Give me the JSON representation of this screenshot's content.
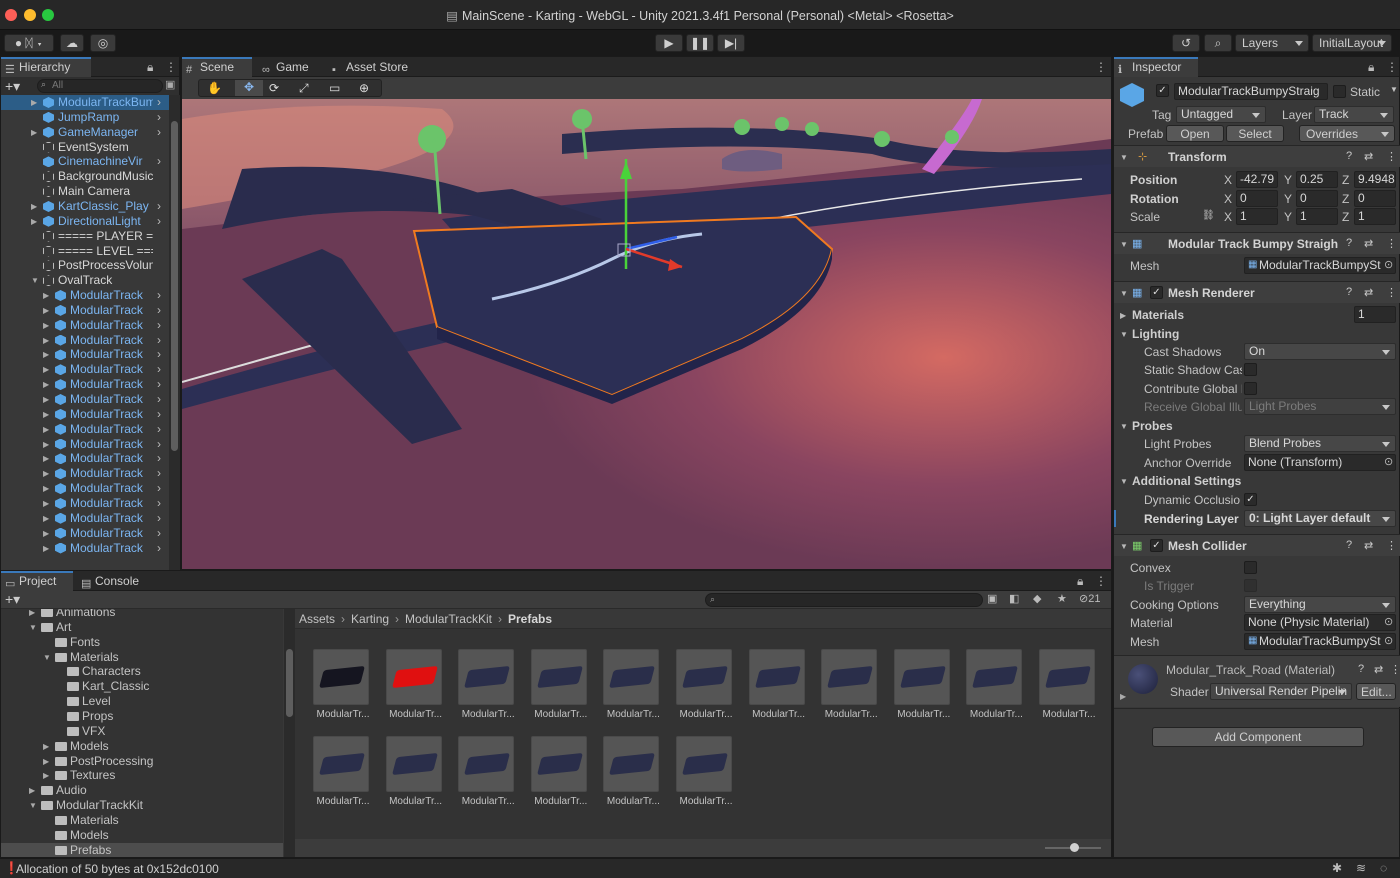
{
  "window": {
    "title": "MainScene - Karting - WebGL - Unity 2021.3.4f1 Personal (Personal) <Metal> <Rosetta>"
  },
  "toolbar": {
    "layers_label": "Layers",
    "layout_label": "InitialLayout"
  },
  "hierarchy": {
    "tab_label": "Hierarchy",
    "search_placeholder": "All",
    "items": [
      {
        "label": "ModularTrackBump",
        "color": "blue",
        "depth": 2,
        "expand": true,
        "chevron": true
      },
      {
        "label": "JumpRamp",
        "color": "blue",
        "depth": 2,
        "expand": false,
        "chevron": true
      },
      {
        "label": "GameManager",
        "color": "blue",
        "depth": 2,
        "expand": true,
        "chevron": true
      },
      {
        "label": "EventSystem",
        "color": "white",
        "depth": 2,
        "expand": false,
        "chevron": false
      },
      {
        "label": "CinemachineVir",
        "color": "blue",
        "depth": 2,
        "expand": false,
        "chevron": true
      },
      {
        "label": "BackgroundMusic",
        "color": "white",
        "depth": 2,
        "expand": false,
        "chevron": false
      },
      {
        "label": "Main Camera",
        "color": "white",
        "depth": 2,
        "expand": false,
        "chevron": false
      },
      {
        "label": "KartClassic_Play",
        "color": "blue",
        "depth": 2,
        "expand": true,
        "chevron": true
      },
      {
        "label": "DirectionalLight",
        "color": "blue",
        "depth": 2,
        "expand": true,
        "chevron": true
      },
      {
        "label": "===== PLAYER ====",
        "color": "white",
        "depth": 2,
        "expand": false,
        "chevron": false
      },
      {
        "label": "===== LEVEL =====",
        "color": "white",
        "depth": 2,
        "expand": false,
        "chevron": false
      },
      {
        "label": "PostProcessVolum",
        "color": "white",
        "depth": 2,
        "expand": false,
        "chevron": false
      },
      {
        "label": "OvalTrack",
        "color": "white",
        "depth": 2,
        "expand": true,
        "open": true,
        "chevron": false
      },
      {
        "label": "ModularTrack",
        "color": "blue",
        "depth": 3,
        "expand": true,
        "chevron": true
      },
      {
        "label": "ModularTrack",
        "color": "blue",
        "depth": 3,
        "expand": true,
        "chevron": true
      },
      {
        "label": "ModularTrack",
        "color": "blue",
        "depth": 3,
        "expand": true,
        "chevron": true
      },
      {
        "label": "ModularTrack",
        "color": "blue",
        "depth": 3,
        "expand": true,
        "chevron": true
      },
      {
        "label": "ModularTrack",
        "color": "blue",
        "depth": 3,
        "expand": true,
        "chevron": true
      },
      {
        "label": "ModularTrack",
        "color": "blue",
        "depth": 3,
        "expand": true,
        "chevron": true
      },
      {
        "label": "ModularTrack",
        "color": "blue",
        "depth": 3,
        "expand": true,
        "chevron": true
      },
      {
        "label": "ModularTrack",
        "color": "blue",
        "depth": 3,
        "expand": true,
        "chevron": true
      },
      {
        "label": "ModularTrack",
        "color": "blue",
        "depth": 3,
        "expand": true,
        "chevron": true
      },
      {
        "label": "ModularTrack",
        "color": "blue",
        "depth": 3,
        "expand": true,
        "chevron": true
      },
      {
        "label": "ModularTrack",
        "color": "blue",
        "depth": 3,
        "expand": true,
        "chevron": true
      },
      {
        "label": "ModularTrack",
        "color": "blue",
        "depth": 3,
        "expand": true,
        "chevron": true
      },
      {
        "label": "ModularTrack",
        "color": "blue",
        "depth": 3,
        "expand": true,
        "chevron": true
      },
      {
        "label": "ModularTrack",
        "color": "blue",
        "depth": 3,
        "expand": true,
        "chevron": true
      },
      {
        "label": "ModularTrack",
        "color": "blue",
        "depth": 3,
        "expand": true,
        "chevron": true
      },
      {
        "label": "ModularTrack",
        "color": "blue",
        "depth": 3,
        "expand": true,
        "chevron": true
      },
      {
        "label": "ModularTrack",
        "color": "blue",
        "depth": 3,
        "expand": true,
        "chevron": true
      },
      {
        "label": "ModularTrack",
        "color": "blue",
        "depth": 3,
        "expand": true,
        "chevron": true
      }
    ]
  },
  "scene_tabs": [
    {
      "label": "Scene",
      "icon": "#"
    },
    {
      "label": "Game",
      "icon": "∞"
    },
    {
      "label": "Asset Store",
      "icon": "▪"
    }
  ],
  "project": {
    "tabs": [
      {
        "label": "Project"
      },
      {
        "label": "Console"
      }
    ],
    "hidden_count": "21",
    "breadcrumb": [
      "Assets",
      "Karting",
      "ModularTrackKit",
      "Prefabs"
    ],
    "folders": [
      {
        "label": "Animations",
        "depth": 1,
        "expand": true,
        "open": false
      },
      {
        "label": "Art",
        "depth": 1,
        "expand": true,
        "open": true
      },
      {
        "label": "Fonts",
        "depth": 2,
        "expand": false,
        "open": false
      },
      {
        "label": "Materials",
        "depth": 2,
        "expand": true,
        "open": true
      },
      {
        "label": "Characters",
        "depth": 3,
        "expand": false,
        "open": false
      },
      {
        "label": "Kart_Classic",
        "depth": 3,
        "expand": false,
        "open": false
      },
      {
        "label": "Level",
        "depth": 3,
        "expand": false,
        "open": false
      },
      {
        "label": "Props",
        "depth": 3,
        "expand": false,
        "open": false
      },
      {
        "label": "VFX",
        "depth": 3,
        "expand": false,
        "open": false
      },
      {
        "label": "Models",
        "depth": 2,
        "expand": true,
        "open": false
      },
      {
        "label": "PostProcessing",
        "depth": 2,
        "expand": true,
        "open": false
      },
      {
        "label": "Textures",
        "depth": 2,
        "expand": true,
        "open": false
      },
      {
        "label": "Audio",
        "depth": 1,
        "expand": true,
        "open": false
      },
      {
        "label": "ModularTrackKit",
        "depth": 1,
        "expand": true,
        "open": true
      },
      {
        "label": "Materials",
        "depth": 2,
        "expand": false,
        "open": false
      },
      {
        "label": "Models",
        "depth": 2,
        "expand": false,
        "open": false
      },
      {
        "label": "Prefabs",
        "depth": 2,
        "expand": false,
        "open": false,
        "selected": true
      }
    ],
    "assets": [
      {
        "label": "ModularTr...",
        "color": "#151520"
      },
      {
        "label": "ModularTr...",
        "color": "#e01010"
      },
      {
        "label": "ModularTr...",
        "color": "#2a2e4a"
      },
      {
        "label": "ModularTr...",
        "color": "#2a2e4a"
      },
      {
        "label": "ModularTr...",
        "color": "#2a2e4a"
      },
      {
        "label": "ModularTr...",
        "color": "#2a2e4a"
      },
      {
        "label": "ModularTr...",
        "color": "#2a2e4a"
      },
      {
        "label": "ModularTr...",
        "color": "#2a2e4a"
      },
      {
        "label": "ModularTr...",
        "color": "#2a2e4a"
      },
      {
        "label": "ModularTr...",
        "color": "#2a2e4a"
      },
      {
        "label": "ModularTr...",
        "color": "#2a2e4a"
      },
      {
        "label": "ModularTr...",
        "color": "#2a2e4a"
      },
      {
        "label": "ModularTr...",
        "color": "#2a2e4a"
      },
      {
        "label": "ModularTr...",
        "color": "#2a2e4a"
      },
      {
        "label": "ModularTr...",
        "color": "#2a2e4a"
      },
      {
        "label": "ModularTr...",
        "color": "#2a2e4a"
      },
      {
        "label": "ModularTr...",
        "color": "#2a2e4a"
      }
    ]
  },
  "inspector": {
    "tab_label": "Inspector",
    "object_name": "ModularTrackBumpyStraig",
    "static_label": "Static",
    "tag_label": "Tag",
    "tag_value": "Untagged",
    "layer_label": "Layer",
    "layer_value": "Track",
    "prefab_label": "Prefab",
    "open_label": "Open",
    "select_label": "Select",
    "overrides_label": "Overrides",
    "transform": {
      "title": "Transform",
      "position_label": "Position",
      "rotation_label": "Rotation",
      "scale_label": "Scale",
      "px": "-42.79",
      "py": "0.25",
      "pz": "9.4948",
      "rx": "0",
      "ry": "0",
      "rz": "0",
      "sx": "1",
      "sy": "1",
      "sz": "1"
    },
    "mesh_filter": {
      "title": "Modular Track Bumpy Straight",
      "mesh_label": "Mesh",
      "mesh_value": "ModularTrackBumpySt"
    },
    "mesh_renderer": {
      "title": "Mesh Renderer",
      "materials_label": "Materials",
      "materials_count": "1",
      "lighting_label": "Lighting",
      "cast_shadows_label": "Cast Shadows",
      "cast_shadows_value": "On",
      "static_shadow_label": "Static Shadow Cas",
      "contribute_gi_label": "Contribute Global I",
      "receive_gi_label": "Receive Global Illu",
      "receive_gi_value": "Light Probes",
      "probes_label": "Probes",
      "light_probes_label": "Light Probes",
      "light_probes_value": "Blend Probes",
      "anchor_label": "Anchor Override",
      "anchor_value": "None (Transform)",
      "additional_label": "Additional Settings",
      "dynamic_occlusion_label": "Dynamic Occlusio",
      "rendering_layer_label": "Rendering Layer M",
      "rendering_layer_value": "0: Light Layer default"
    },
    "mesh_collider": {
      "title": "Mesh Collider",
      "convex_label": "Convex",
      "is_trigger_label": "Is Trigger",
      "cooking_label": "Cooking Options",
      "cooking_value": "Everything",
      "material_label": "Material",
      "material_value": "None (Physic Material)",
      "mesh_label": "Mesh",
      "mesh_value": "ModularTrackBumpySt"
    },
    "material": {
      "title": "Modular_Track_Road (Material)",
      "shader_label": "Shader",
      "shader_value": "Universal Render Pipelin",
      "edit_label": "Edit..."
    },
    "add_component_label": "Add Component"
  },
  "status": {
    "message": "Allocation of 50 bytes at 0x152dc0100"
  },
  "colors": {
    "accent": "#3a79bb",
    "prefab_blue": "#7cb6f2",
    "selection_orange": "#f07a20",
    "scene_sky": "#c9857c",
    "scene_ground": "#6b3a55",
    "track": "#2c2f55"
  }
}
